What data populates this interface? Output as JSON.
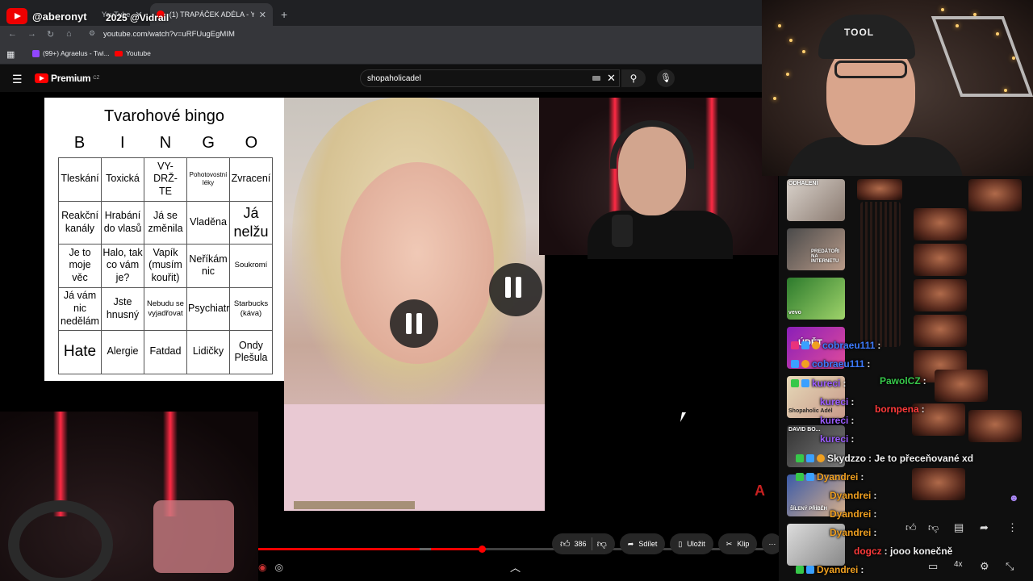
{
  "overlay": {
    "handle": "@aberonyt",
    "handle_tail": "2025 @Vidrail"
  },
  "browser": {
    "tabs": [
      {
        "label": "YouTube",
        "active": false
      },
      {
        "label": "(1) TRAPÁČEK ADÉLA - YouTube",
        "active": true
      }
    ],
    "new_tab": "+",
    "url": "youtube.com/watch?v=uRFUugEgMIM",
    "bookmarks": [
      {
        "label": "(99+) Agraelus - Twi...",
        "icon": "twitch-icon"
      },
      {
        "label": "Youtube",
        "icon": "youtube-icon"
      }
    ]
  },
  "youtube": {
    "logo": "Premium",
    "region": "CZ",
    "search_value": "shopaholicadel",
    "actions": {
      "likes": "386",
      "share": "Sdílet",
      "save": "Uložit",
      "clip": "Klip",
      "more": "⋯"
    },
    "progress_fraction": 0.43
  },
  "bingo": {
    "title": "Tvarohové bingo",
    "letters": [
      "B",
      "I",
      "N",
      "G",
      "O"
    ],
    "grid": [
      [
        "Tleskání",
        "Toxická",
        "VY-\nDRŽ-\nTE",
        "Pohotovostní léky",
        "Zvracení"
      ],
      [
        "Reakční kanály",
        "Hrabání do vlasů",
        "Já se změnila",
        "Vladěna",
        "Já nelžu"
      ],
      [
        "Je to moje věc",
        "Halo, tak co vám je?",
        "Vapík (musím kouřit)",
        "Neříkám nic",
        "Soukromí"
      ],
      [
        "Já vám nic nedělám",
        "Jste hnusný",
        "Nebudu se vyjadřovat",
        "Psychiatr",
        "Starbucks (káva)"
      ],
      [
        "Hate",
        "Alergie",
        "Fatdad",
        "Lidičky",
        "Ondy Plešula"
      ]
    ]
  },
  "chat": {
    "messages": [
      {
        "user": "cobraeu111",
        "text": ":",
        "color": "#3d7bff"
      },
      {
        "user": "cobraeu111",
        "text": ":",
        "color": "#3d7bff"
      },
      {
        "user": "PawolCZ",
        "text": ":",
        "color": "#37c84a"
      },
      {
        "user": "kureci",
        "text": ":",
        "color": "#9b5cff"
      },
      {
        "user": "kureci",
        "text": ":",
        "color": "#9b5cff"
      },
      {
        "user": "bornpena",
        "text": ":",
        "color": "#ff3b3b"
      },
      {
        "user": "kureci",
        "text": ":",
        "color": "#9b5cff"
      },
      {
        "user": "kureci",
        "text": ":",
        "color": "#9b5cff"
      },
      {
        "user": "Skydzzo",
        "text": ": Je to přeceňované xd",
        "color": "#f2f2f2"
      },
      {
        "user": "Dyandrei",
        "text": ":",
        "color": "#f0a020"
      },
      {
        "user": "Dyandrei",
        "text": ":",
        "color": "#f0a020"
      },
      {
        "user": "Dyandrei",
        "text": ":",
        "color": "#f0a020"
      },
      {
        "user": "Dyandrei",
        "text": ":",
        "color": "#f0a020"
      },
      {
        "user": "dogcz",
        "text": ": jooo konečně",
        "color": "#ff3b3b"
      },
      {
        "user": "Dyandrei",
        "text": ":",
        "color": "#f0a020"
      }
    ],
    "thumbs": [
      {
        "label": "ODHALENÍ"
      },
      {
        "label": "PREDÁTOŘI NA INTERNETU"
      },
      {
        "label": "vevo"
      },
      {
        "label": "ÚDĚT"
      },
      {
        "label": "Shopaholic Adél"
      },
      {
        "label": "DAVID BO..."
      },
      {
        "label": "ŠÍLENÝ PŘÍBĚH"
      }
    ]
  },
  "colors": {
    "accent": "#ff0000",
    "bg": "#0f0f0f"
  }
}
